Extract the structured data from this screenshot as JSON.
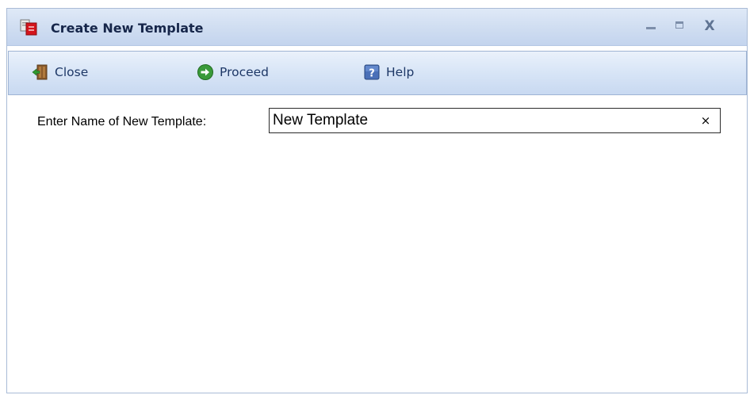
{
  "window": {
    "title": "Create New Template",
    "title_icon": "template-create-icon",
    "controls": {
      "minimize_icon": "minimize-icon",
      "maximize_icon": "maximize-icon",
      "close_glyph": "X"
    }
  },
  "toolbar": {
    "items": [
      {
        "label": "Close",
        "icon": "exit-door-icon"
      },
      {
        "label": "Proceed",
        "icon": "green-arrow-circle-icon"
      },
      {
        "label": "Help",
        "icon": "question-mark-icon"
      }
    ]
  },
  "form": {
    "name_label": "Enter Name of New Template:",
    "name_value": "New Template",
    "clear_glyph": "×"
  },
  "colors": {
    "title_bar": "#cfddf1",
    "toolbar": "#d9e6f7",
    "title_text": "#16264a",
    "toolbar_text": "#1d3766",
    "proceed_green": "#3a9a3a"
  }
}
